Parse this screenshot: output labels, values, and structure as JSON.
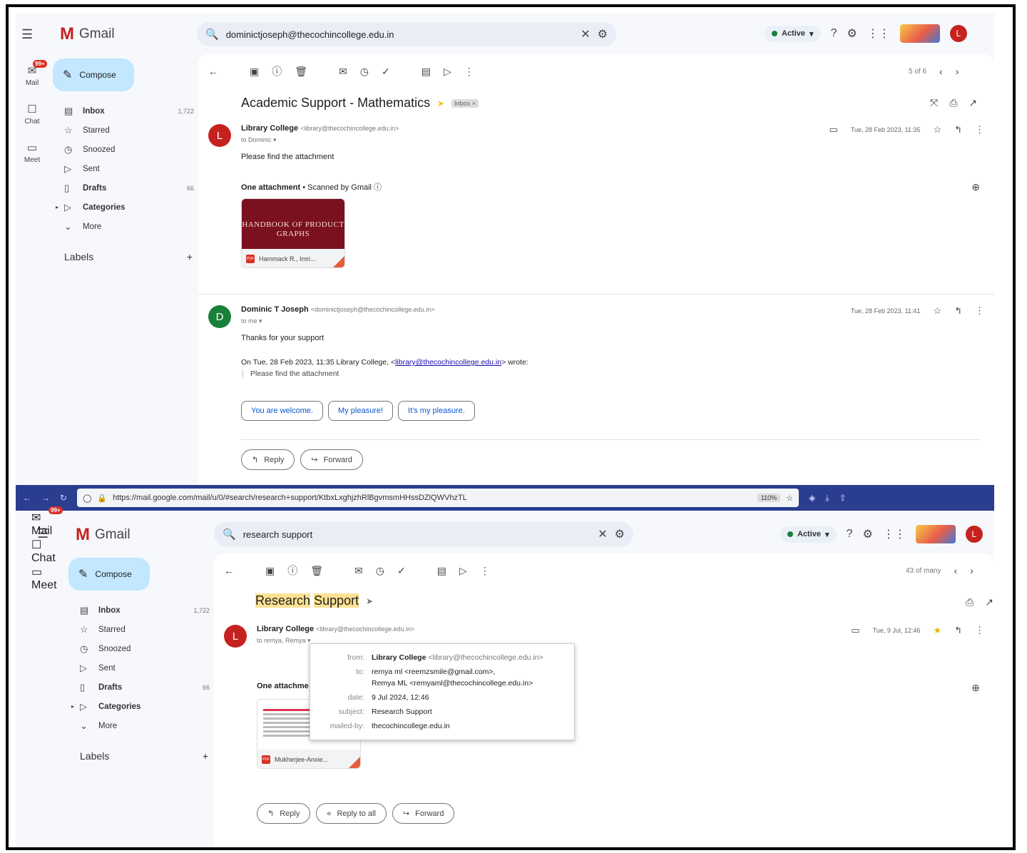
{
  "top": {
    "app_name": "Gmail",
    "rail": {
      "mail_badge": "99+",
      "mail": "Mail",
      "chat": "Chat",
      "meet": "Meet"
    },
    "search": {
      "value": "dominictjoseph@thecochincollege.edu.in"
    },
    "status": "Active",
    "avatar_letter": "L",
    "compose": "Compose",
    "nav": [
      {
        "label": "Inbox",
        "count": "1,722",
        "icon": "inbox-icon"
      },
      {
        "label": "Starred",
        "count": "",
        "icon": "star-icon"
      },
      {
        "label": "Snoozed",
        "count": "",
        "icon": "clock-icon"
      },
      {
        "label": "Sent",
        "count": "",
        "icon": "send-icon"
      },
      {
        "label": "Drafts",
        "count": "66",
        "icon": "draft-icon"
      },
      {
        "label": "Categories",
        "count": "",
        "icon": "label-icon"
      },
      {
        "label": "More",
        "count": "",
        "icon": "chevron-down-icon"
      }
    ],
    "labels_heading": "Labels",
    "pager": "5 of 6",
    "subject": "Academic Support - Mathematics",
    "subject_tag": "Inbox ×",
    "messages": [
      {
        "avatar": "L",
        "avatar_color": "#c5221f",
        "sender": "Library College",
        "email": "<library@thecochincollege.edu.in>",
        "to": "to Dominic ▾",
        "date": "Tue, 28 Feb 2023, 11:35",
        "body": "Please find the attachment",
        "attachment_title": "One attachment",
        "attachment_scan": " • Scanned by Gmail ⓘ",
        "attachment_cover": "HANDBOOK OF PRODUCT GRAPHS",
        "attachment_name": "Hammack R., Imri..."
      },
      {
        "avatar": "D",
        "avatar_color": "#188038",
        "sender": "Dominic T Joseph",
        "email": "<dominictjoseph@thecochincollege.edu.in>",
        "to": "to me ▾",
        "date": "Tue, 28 Feb 2023, 11:41",
        "body": "Thanks for your support",
        "quote_prefix": "On Tue, 28 Feb 2023, 11:35 Library College, <",
        "quote_link": "library@thecochincollege.edu.in",
        "quote_suffix": "> wrote:",
        "quote_text": "Please find the attachment"
      }
    ],
    "smart_replies": [
      "You are welcome.",
      "My pleasure!",
      "It's my pleasure."
    ],
    "actions": [
      "Reply",
      "Forward"
    ]
  },
  "bottom": {
    "browser": {
      "url": "https://mail.google.com/mail/u/0/#search/research+support/KtbxLxghjzhRlBgvmsmHHssDZlQWVhzTL",
      "zoom": "110%"
    },
    "app_name": "Gmail",
    "rail": {
      "mail_badge": "99+",
      "mail": "Mail",
      "chat": "Chat",
      "meet": "Meet"
    },
    "search": {
      "value": "research support"
    },
    "status": "Active",
    "avatar_letter": "L",
    "compose": "Compose",
    "nav": [
      {
        "label": "Inbox",
        "count": "1,722",
        "icon": "inbox-icon"
      },
      {
        "label": "Starred",
        "count": "",
        "icon": "star-icon"
      },
      {
        "label": "Snoozed",
        "count": "",
        "icon": "clock-icon"
      },
      {
        "label": "Sent",
        "count": "",
        "icon": "send-icon"
      },
      {
        "label": "Drafts",
        "count": "66",
        "icon": "draft-icon"
      },
      {
        "label": "Categories",
        "count": "",
        "icon": "label-icon"
      },
      {
        "label": "More",
        "count": "",
        "icon": "chevron-down-icon"
      }
    ],
    "labels_heading": "Labels",
    "pager": "43 of many",
    "subject_part1": "Research",
    "subject_part2": "Support",
    "message": {
      "avatar": "L",
      "avatar_color": "#c5221f",
      "sender": "Library College",
      "email": "<library@thecochincollege.edu.in>",
      "to": "to remya, Remya ▾",
      "date": "Tue, 9 Jul, 12:46",
      "attachment_title": "One attachme",
      "attachment_name": "Mukherjee-Anxie..."
    },
    "details": {
      "from_label": "from:",
      "from_name": "Library College",
      "from_email": "<library@thecochincollege.edu.in>",
      "to_label": "to:",
      "to_line1": "remya ml <reemzsmile@gmail.com>,",
      "to_line2": "Remya ML <remyaml@thecochincollege.edu.in>",
      "date_label": "date:",
      "date_value": "9 Jul 2024, 12:46",
      "subject_label": "subject:",
      "subject_value": "Research Support",
      "mailed_label": "mailed-by:",
      "mailed_value": "thecochincollege.edu.in"
    },
    "actions": [
      "Reply",
      "Reply to all",
      "Forward"
    ]
  }
}
